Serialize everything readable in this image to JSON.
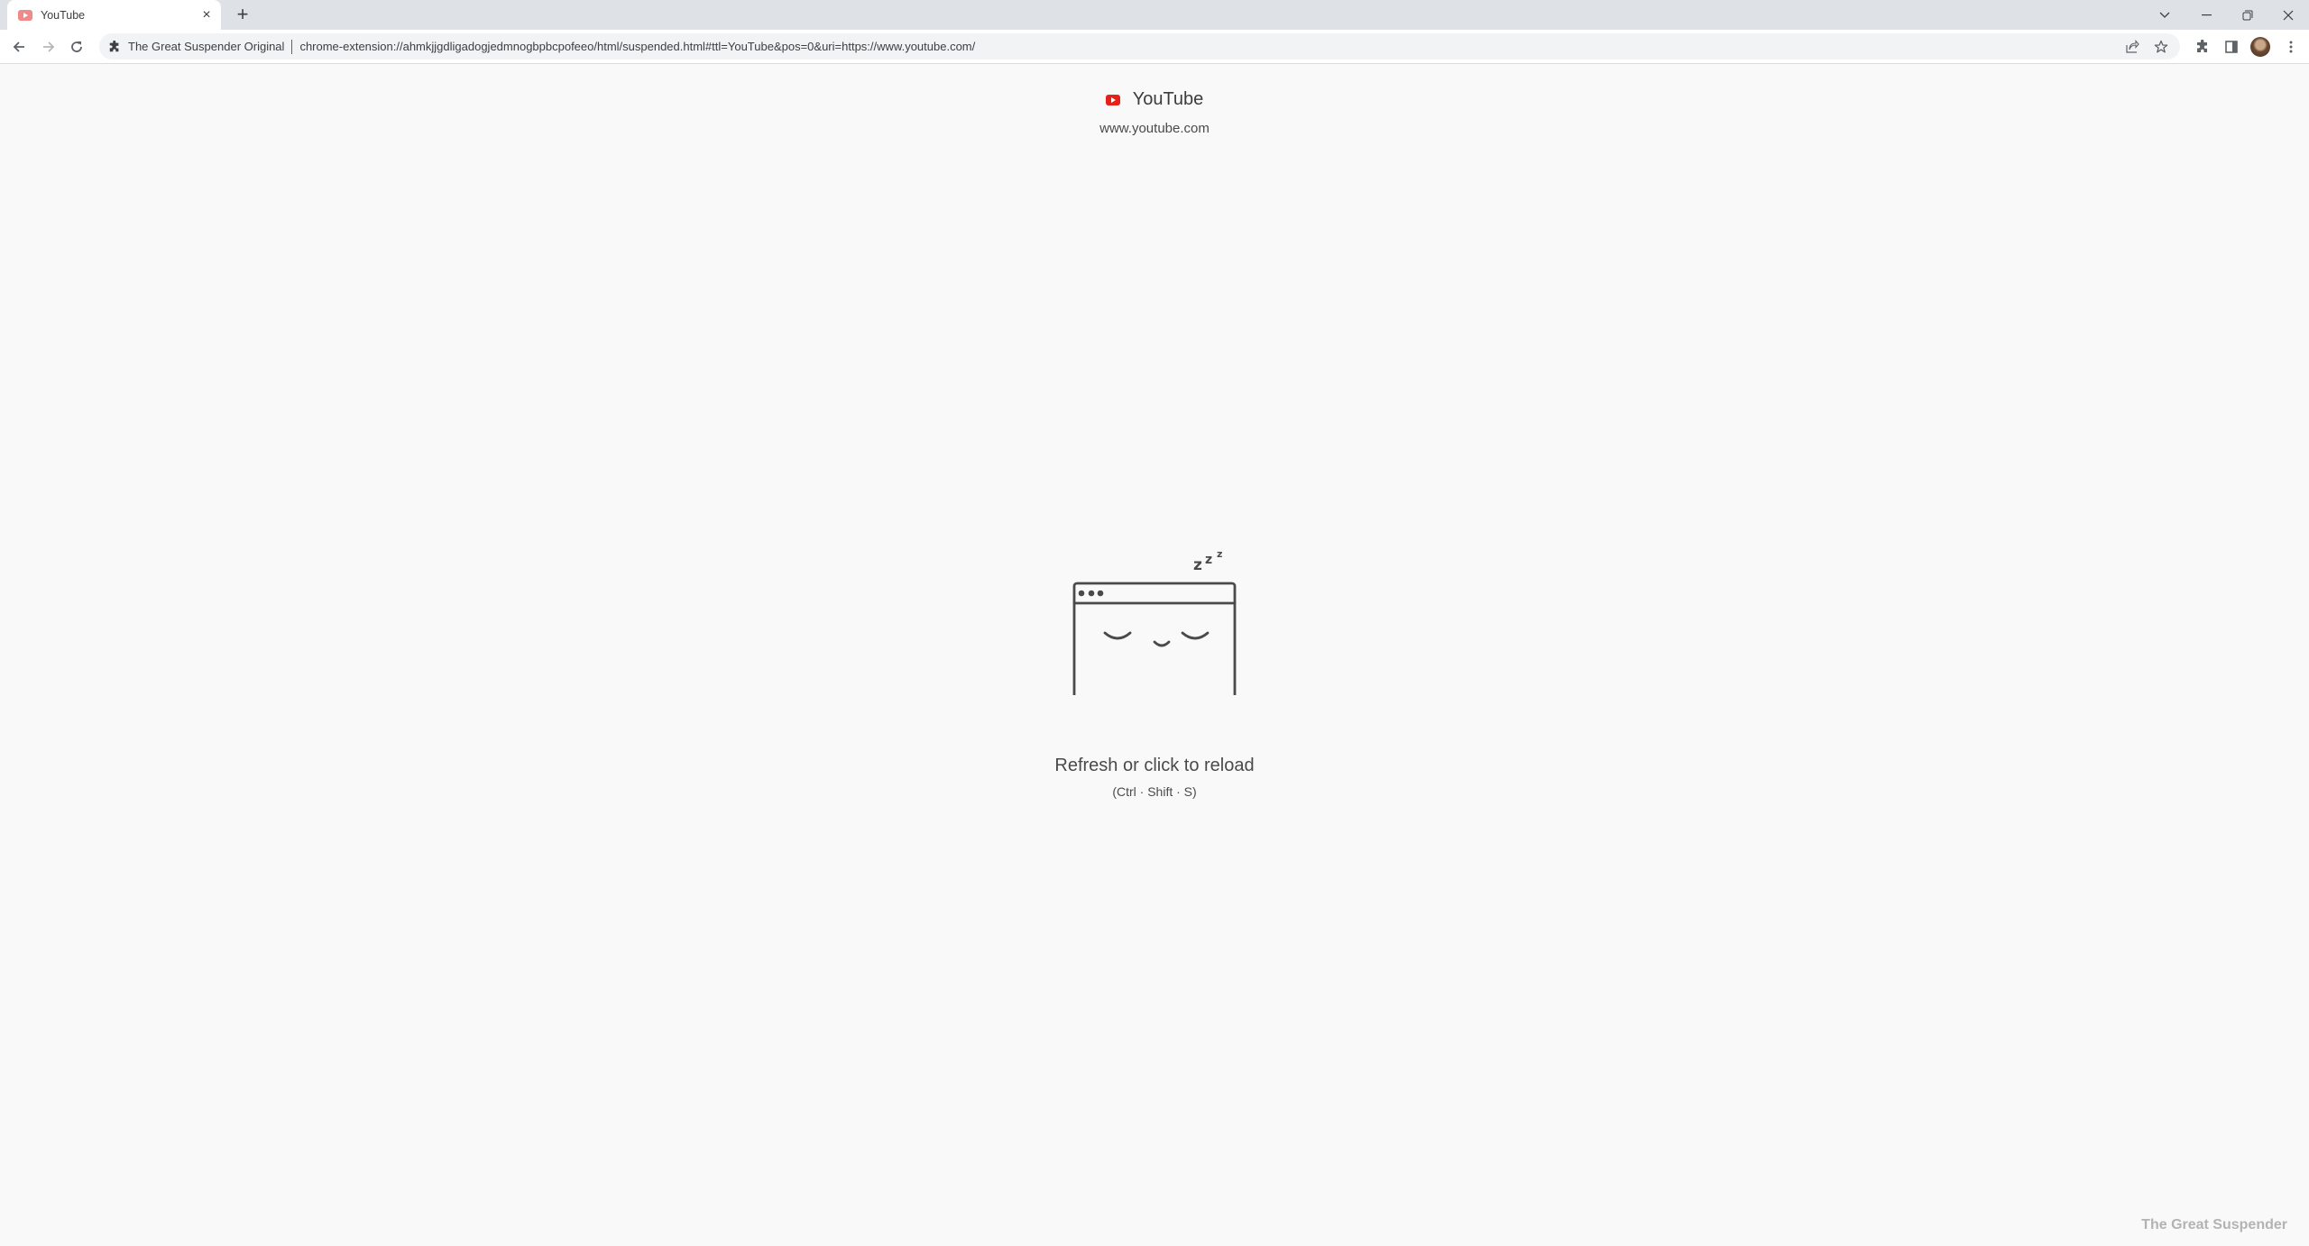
{
  "browser": {
    "tab": {
      "title": "YouTube",
      "favicon": "youtube-favicon-faded"
    },
    "new_tab_label": "+",
    "window_controls": {
      "tab_search": "⌄",
      "minimize": "—",
      "restore": "❐",
      "close": "✕"
    },
    "omnibox": {
      "origin_label": "The Great Suspender Original",
      "url": "chrome-extension://ahmkjjgdligadogjedmnogbpbcpofeeo/html/suspended.html#ttl=YouTube&pos=0&uri=https://www.youtube.com/"
    }
  },
  "page": {
    "site_title": "YouTube",
    "site_url": "www.youtube.com",
    "reload_message": "Refresh or click to reload",
    "shortcut": "(Ctrl · Shift · S)",
    "branding": "The Great Suspender",
    "colors": {
      "background": "#f9f9f9",
      "favicon_red": "#e62117",
      "illustration_stroke": "#4a4a4a"
    }
  }
}
